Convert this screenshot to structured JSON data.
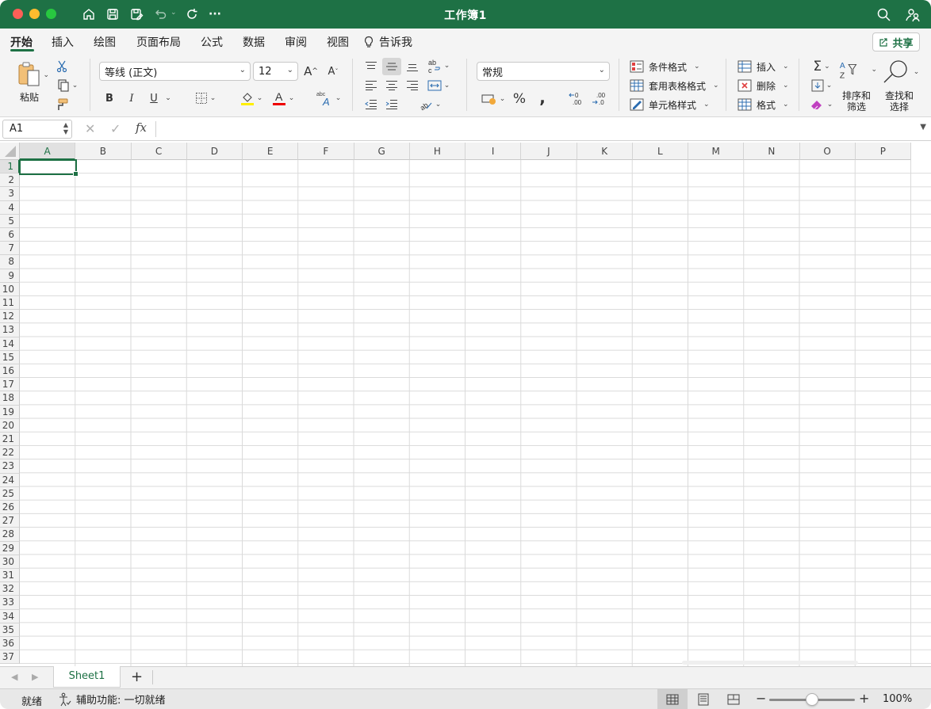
{
  "window": {
    "title": "工作簿1"
  },
  "menu": {
    "tabs": [
      "开始",
      "插入",
      "绘图",
      "页面布局",
      "公式",
      "数据",
      "审阅",
      "视图"
    ],
    "tell_me": "告诉我",
    "share": "共享"
  },
  "ribbon": {
    "paste": "粘贴",
    "font_name": "等线 (正文)",
    "font_size": "12",
    "bold": "B",
    "italic": "I",
    "underline": "U",
    "number_format": "常规",
    "conditional_format": "条件格式",
    "format_as_table": "套用表格格式",
    "cell_styles": "单元格样式",
    "insert": "插入",
    "delete": "删除",
    "format": "格式",
    "sort_filter": [
      "排序和",
      "筛选"
    ],
    "find_select": [
      "查找和",
      "选择"
    ]
  },
  "formula_bar": {
    "name_box": "A1",
    "fx": "fx",
    "value": ""
  },
  "grid": {
    "columns": [
      "A",
      "B",
      "C",
      "D",
      "E",
      "F",
      "G",
      "H",
      "I",
      "J",
      "K",
      "L",
      "M",
      "N",
      "O",
      "P"
    ],
    "rows": [
      "1",
      "2",
      "3",
      "4",
      "5",
      "6",
      "7",
      "8",
      "9",
      "10",
      "11",
      "12",
      "13",
      "14",
      "15",
      "16",
      "17",
      "18",
      "19",
      "20",
      "21",
      "22",
      "23",
      "24",
      "25",
      "26",
      "27",
      "28",
      "29",
      "30",
      "31",
      "32",
      "33",
      "34",
      "35",
      "36",
      "37"
    ],
    "active_cell": "A1"
  },
  "sheets": {
    "tabs": [
      "Sheet1"
    ],
    "add": "+"
  },
  "status": {
    "ready": "就绪",
    "accessibility": "辅助功能: 一切就绪",
    "zoom": "100%",
    "zoom_level": 0.5
  },
  "colors": {
    "brand": "#1e7145"
  },
  "icons": [
    "home-icon",
    "save-icon",
    "save-as-icon",
    "undo-icon",
    "redo-icon",
    "more-icon",
    "search-icon",
    "share-people-icon",
    "lightbulb-icon",
    "cut-icon",
    "copy-icon",
    "format-painter-icon",
    "paste-icon"
  ]
}
